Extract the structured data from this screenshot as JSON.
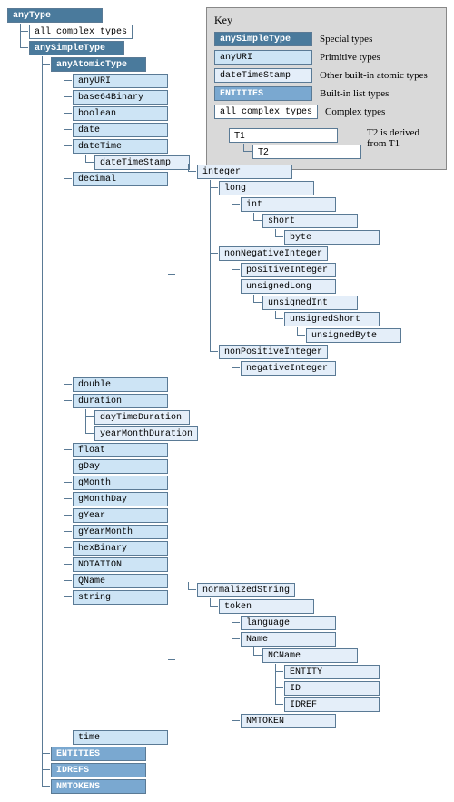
{
  "key": {
    "title": "Key",
    "rows": [
      {
        "label": "anySimpleType",
        "class": "special",
        "desc": "Special types"
      },
      {
        "label": "anyURI",
        "class": "primitive",
        "desc": "Primitive types"
      },
      {
        "label": "dateTimeStamp",
        "class": "other",
        "desc": "Other built-in atomic types"
      },
      {
        "label": "ENTITIES",
        "class": "listtype",
        "desc": "Built-in list types"
      },
      {
        "label": "all complex types",
        "class": "complex",
        "desc": "Complex types"
      }
    ],
    "derive": {
      "t1": "T1",
      "t2": "T2",
      "desc": "T2 is derived from T1"
    }
  },
  "root": {
    "label": "anyType",
    "class": "special"
  },
  "allComplex": {
    "label": "all complex types",
    "class": "complex"
  },
  "anySimple": {
    "label": "anySimpleType",
    "class": "special"
  },
  "anyAtomic": {
    "label": "anyAtomicType",
    "class": "special"
  },
  "atomic": {
    "anyURI": "anyURI",
    "base64Binary": "base64Binary",
    "boolean": "boolean",
    "date": "date",
    "dateTime": "dateTime",
    "dateTimeStamp": "dateTimeStamp",
    "decimal": "decimal",
    "double": "double",
    "duration": "duration",
    "dayTimeDuration": "dayTimeDuration",
    "yearMonthDuration": "yearMonthDuration",
    "float": "float",
    "gDay": "gDay",
    "gMonth": "gMonth",
    "gMonthDay": "gMonthDay",
    "gYear": "gYear",
    "gYearMonth": "gYearMonth",
    "hexBinary": "hexBinary",
    "NOTATION": "NOTATION",
    "QName": "QName",
    "string": "string",
    "time": "time"
  },
  "decimalTree": {
    "integer": "integer",
    "long": "long",
    "int": "int",
    "short": "short",
    "byte": "byte",
    "nonNegativeInteger": "nonNegativeInteger",
    "positiveInteger": "positiveInteger",
    "unsignedLong": "unsignedLong",
    "unsignedInt": "unsignedInt",
    "unsignedShort": "unsignedShort",
    "unsignedByte": "unsignedByte",
    "nonPositiveInteger": "nonPositiveInteger",
    "negativeInteger": "negativeInteger"
  },
  "stringTree": {
    "normalizedString": "normalizedString",
    "token": "token",
    "language": "language",
    "Name": "Name",
    "NCName": "NCName",
    "ENTITY": "ENTITY",
    "ID": "ID",
    "IDREF": "IDREF",
    "NMTOKEN": "NMTOKEN"
  },
  "lists": {
    "ENTITIES": "ENTITIES",
    "IDREFS": "IDREFS",
    "NMTOKENS": "NMTOKENS"
  }
}
